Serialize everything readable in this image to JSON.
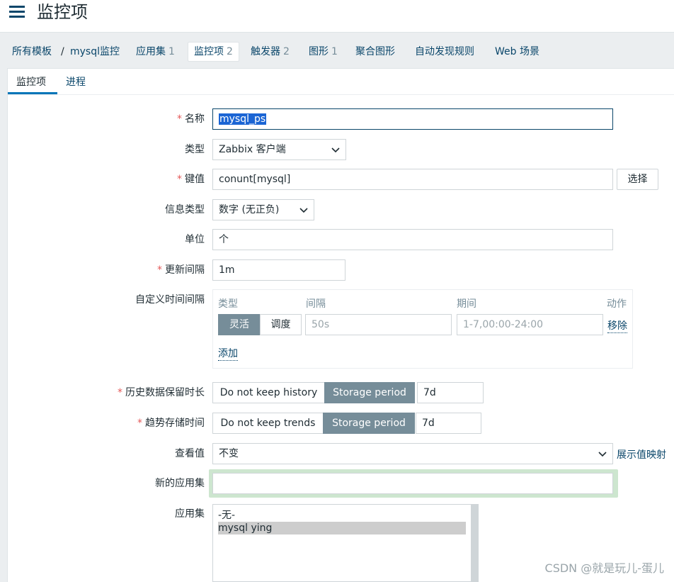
{
  "header": {
    "title": "监控项"
  },
  "breadcrumb": {
    "root": "所有模板",
    "separator": "/",
    "host": "mysql监控",
    "items": [
      {
        "label": "应用集",
        "count": "1"
      },
      {
        "label": "监控项",
        "count": "2"
      },
      {
        "label": "触发器",
        "count": "2"
      },
      {
        "label": "图形",
        "count": "1"
      },
      {
        "label": "聚合图形",
        "count": ""
      },
      {
        "label": "自动发现规则",
        "count": ""
      },
      {
        "label": "Web 场景",
        "count": ""
      }
    ]
  },
  "tabs": {
    "items": "监控项",
    "process": "进程"
  },
  "form": {
    "required_mark": "*",
    "name": {
      "label": "名称",
      "value": "mysql_ps"
    },
    "type": {
      "label": "类型",
      "value": "Zabbix 客户端"
    },
    "key": {
      "label": "键值",
      "value": "conunt[mysql]",
      "select_button": "选择"
    },
    "info_type": {
      "label": "信息类型",
      "value": "数字 (无正负)"
    },
    "units": {
      "label": "单位",
      "value": "个"
    },
    "update_interval": {
      "label": "更新间隔",
      "value": "1m"
    },
    "custom_intervals": {
      "label": "自定义时间间隔",
      "col_type": "类型",
      "col_interval": "间隔",
      "col_period": "期间",
      "col_action": "动作",
      "flexible": "灵活",
      "scheduling": "调度",
      "interval_placeholder": "50s",
      "period_placeholder": "1-7,00:00-24:00",
      "remove": "移除",
      "add": "添加"
    },
    "history": {
      "label": "历史数据保留时长",
      "off": "Do not keep history",
      "on": "Storage period",
      "value": "7d"
    },
    "trends": {
      "label": "趋势存储时间",
      "off": "Do not keep trends",
      "on": "Storage period",
      "value": "7d"
    },
    "value_map": {
      "label": "查看值",
      "value": "不变",
      "link": "展示值映射"
    },
    "new_application": {
      "label": "新的应用集",
      "value": ""
    },
    "applications": {
      "label": "应用集",
      "options": [
        "-无-",
        "mysql ying"
      ]
    }
  },
  "watermark": "CSDN @就是玩儿-蛋儿",
  "colors": {
    "link": "#0a466a",
    "accent": "#0275b8",
    "toggle_on": "#768d99",
    "required": "#e45959"
  }
}
